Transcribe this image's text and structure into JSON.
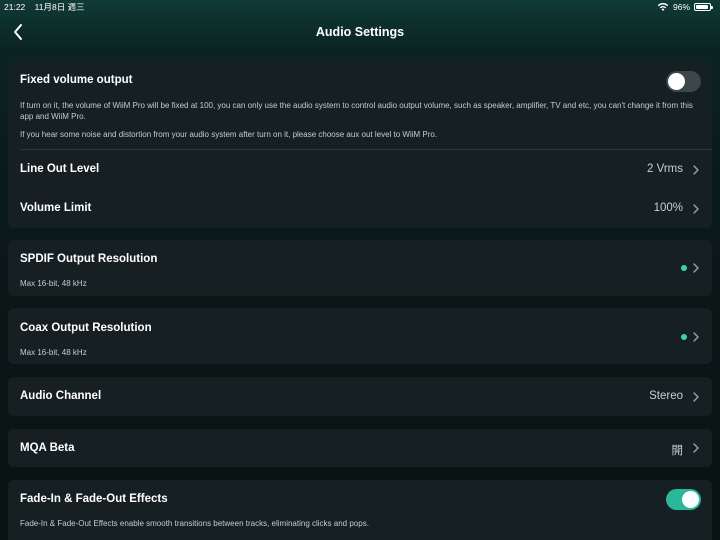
{
  "status_bar": {
    "time": "21:22",
    "date": "11月8日 週三",
    "battery_text": "96%",
    "battery_level": 0.96,
    "wifi_icon": "wifi-icon"
  },
  "nav": {
    "title": "Audio Settings",
    "back_icon": "chevron-left-icon"
  },
  "fixed_volume": {
    "label": "Fixed volume output",
    "enabled": false,
    "description_1": "If turn on it, the volume of WiiM Pro will be fixed at 100, you can only use the audio system to control audio output volume, such as speaker, amplifier, TV and etc, you can't change it from this app and WiiM Pro.",
    "description_2": "If you hear some noise and distortion from your audio system after turn on it, please choose aux out level to WiiM Pro."
  },
  "line_out_level": {
    "label": "Line Out Level",
    "value": "2 Vrms"
  },
  "volume_limit": {
    "label": "Volume Limit",
    "value": "100%"
  },
  "spdif": {
    "label": "SPDIF Output Resolution",
    "sub": "Max 16-bit, 48 kHz"
  },
  "coax": {
    "label": "Coax Output Resolution",
    "sub": "Max 16-bit, 48 kHz"
  },
  "audio_channel": {
    "label": "Audio Channel",
    "value": "Stereo"
  },
  "mqa": {
    "label": "MQA Beta",
    "value": "開"
  },
  "fade": {
    "label": "Fade-In & Fade-Out Effects",
    "enabled": true,
    "description": "Fade-In & Fade-Out Effects enable smooth transitions between tracks, eliminating clicks and pops."
  },
  "colors": {
    "accent": "#2bb89a",
    "indicator_dot": "#3fd0b0",
    "card_bg": "#162023"
  }
}
